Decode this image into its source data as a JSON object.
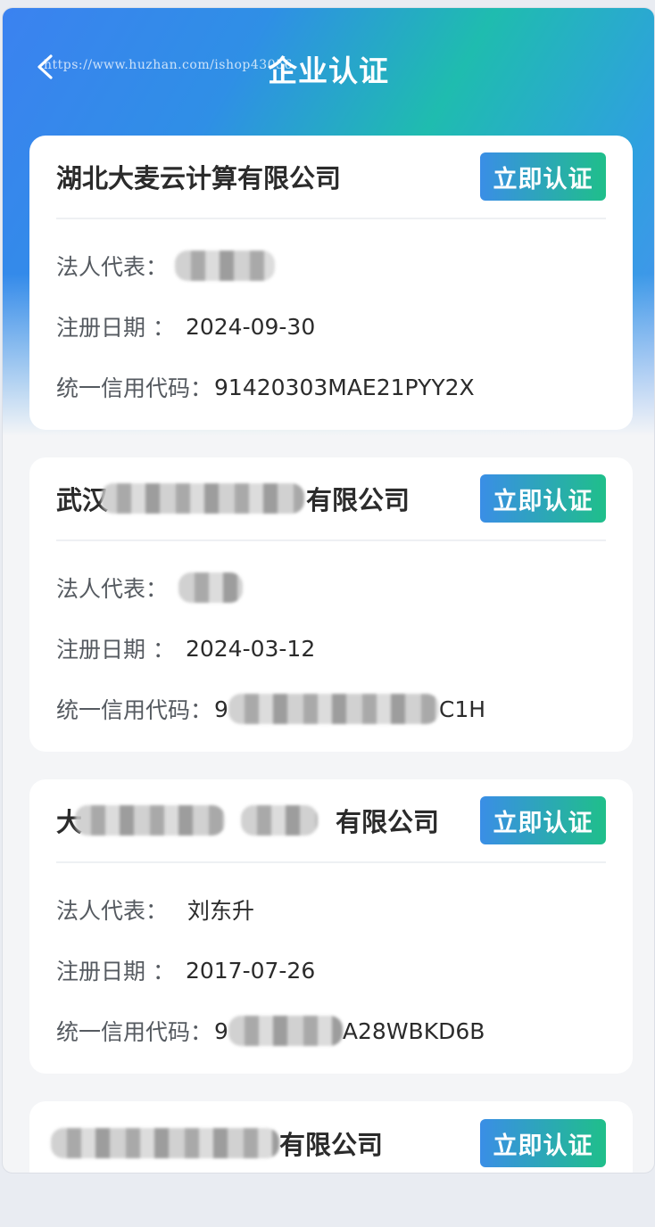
{
  "header": {
    "title": "企业认证",
    "watermark": "https://www.huzhan.com/ishop43056"
  },
  "cards": [
    {
      "company_prefix": "湖北大麦云计算有限公司",
      "company_suffix": "",
      "button": "立即认证",
      "legal_label": "法人代表：",
      "legal_value": "",
      "date_label": "注册日期 ：",
      "date_value": "2024-09-30",
      "code_label": "统一信用代码：",
      "code_prefix": "91420303MAE21PYY2X",
      "code_suffix": ""
    },
    {
      "company_prefix": "武汉",
      "company_suffix": "有限公司",
      "button": "立即认证",
      "legal_label": "法人代表：",
      "legal_value": "",
      "date_label": "注册日期 ：",
      "date_value": "2024-03-12",
      "code_label": "统一信用代码：",
      "code_prefix": "9",
      "code_suffix": "C1H"
    },
    {
      "company_prefix": "大",
      "company_suffix": "有限公司",
      "button": "立即认证",
      "legal_label": "法人代表：",
      "legal_value": "刘东升",
      "date_label": "注册日期 ：",
      "date_value": "2017-07-26",
      "code_label": "统一信用代码：",
      "code_prefix": "9",
      "code_suffix": "A28WBKD6B"
    },
    {
      "company_prefix": "",
      "company_suffix": "有限公司",
      "button": "立即认证"
    }
  ],
  "colors": {
    "accent_start": "#3a8ee6",
    "accent_end": "#1fbf8a",
    "header_blue": "#3b82f0",
    "header_teal": "#1fbcaf"
  },
  "icons": {
    "back": "chevron-left-icon"
  }
}
